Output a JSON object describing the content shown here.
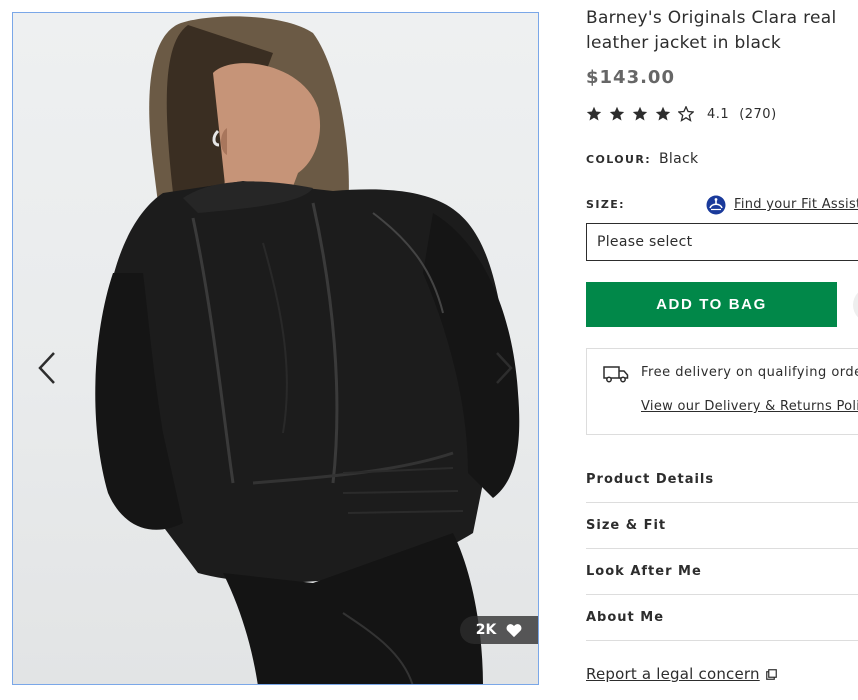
{
  "gallery": {
    "prev_icon": "chevron-left-icon",
    "next_icon": "chevron-right-icon",
    "likes_count": "2K",
    "likes_icon": "heart-icon"
  },
  "product": {
    "title": "Barney's Originals Clara real leather jacket in black",
    "price": "$143.00",
    "rating": {
      "value": "4.1",
      "count": "(270)",
      "stars_value": 4.1,
      "stars_max": 5
    },
    "colour_label": "COLOUR:",
    "colour_value": "Black",
    "size_label": "SIZE:",
    "fit_link": "Find your Fit Assistant",
    "size_select": "Please select",
    "add_to_bag": "ADD TO BAG",
    "delivery_text": "Free delivery on qualifying orders.",
    "delivery_link": "View our Delivery & Returns Policy",
    "accordion": [
      {
        "label": "Product Details"
      },
      {
        "label": "Size & Fit"
      },
      {
        "label": "Look After Me"
      },
      {
        "label": "About Me"
      }
    ],
    "legal_link": "Report a legal concern"
  },
  "colors": {
    "accent_green": "#018849",
    "text": "#2d2d2d",
    "price": "#666666",
    "fit_icon_blue": "#1a3a9b"
  }
}
